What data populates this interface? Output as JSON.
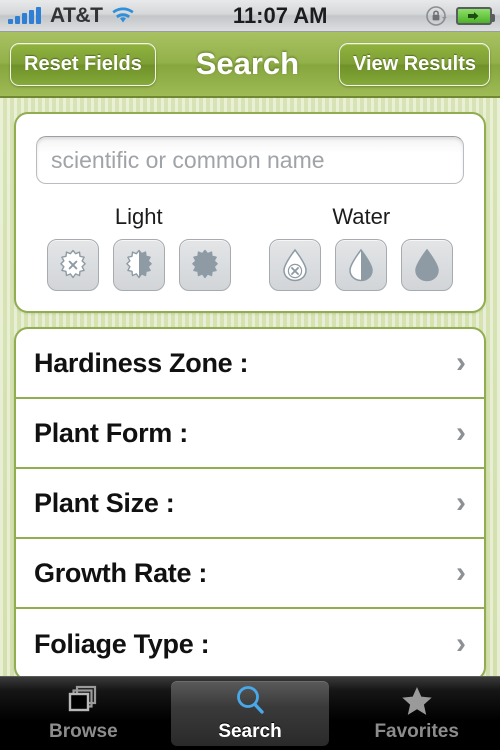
{
  "statusbar": {
    "carrier": "AT&T",
    "time": "11:07 AM",
    "signal_icon": "signal-bars-icon",
    "wifi_icon": "wifi-icon",
    "rotation_lock_icon": "rotation-lock-icon",
    "battery_icon": "battery-charging-icon"
  },
  "navbar": {
    "left_button": "Reset Fields",
    "title": "Search",
    "right_button": "View Results",
    "accent_color": "#93b14a"
  },
  "search": {
    "placeholder": "scientific or common name",
    "value": ""
  },
  "light": {
    "label": "Light",
    "options": [
      {
        "name": "sun-none-icon",
        "state": "none"
      },
      {
        "name": "sun-partial-icon",
        "state": "partial"
      },
      {
        "name": "sun-full-icon",
        "state": "full"
      }
    ]
  },
  "water": {
    "label": "Water",
    "options": [
      {
        "name": "droplet-none-icon",
        "state": "none"
      },
      {
        "name": "droplet-partial-icon",
        "state": "partial"
      },
      {
        "name": "droplet-full-icon",
        "state": "full"
      }
    ]
  },
  "filters": [
    {
      "label": "Hardiness Zone :",
      "value": ""
    },
    {
      "label": "Plant Form :",
      "value": ""
    },
    {
      "label": "Plant Size :",
      "value": ""
    },
    {
      "label": "Growth Rate :",
      "value": ""
    },
    {
      "label": "Foliage Type :",
      "value": ""
    }
  ],
  "tabbar": {
    "tabs": [
      {
        "label": "Browse",
        "icon": "stacked-squares-icon",
        "selected": false
      },
      {
        "label": "Search",
        "icon": "magnifying-glass-icon",
        "selected": true
      },
      {
        "label": "Favorites",
        "icon": "star-icon",
        "selected": false
      }
    ]
  }
}
